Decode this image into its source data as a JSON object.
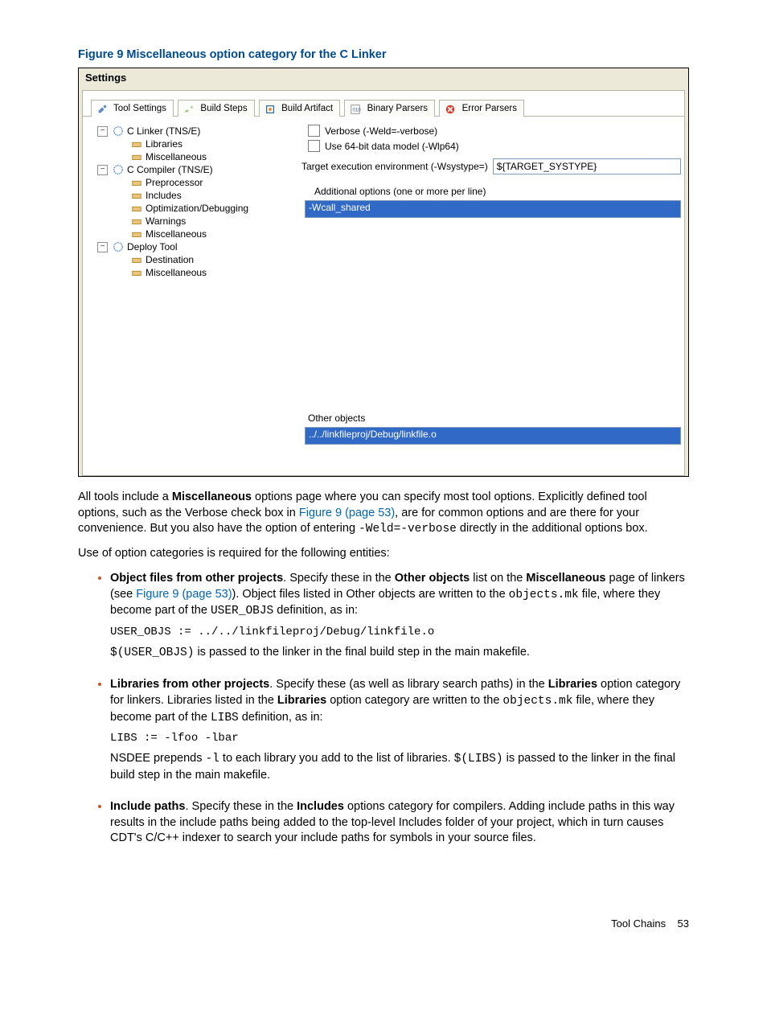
{
  "figure": {
    "caption": "Figure 9 Miscellaneous option category for the C Linker"
  },
  "settings": {
    "title": "Settings",
    "tabs": {
      "tool_settings": "Tool Settings",
      "build_steps": "Build Steps",
      "build_artifact": "Build Artifact",
      "binary_parsers": "Binary Parsers",
      "error_parsers": "Error Parsers"
    },
    "tree": {
      "c_linker": "C Linker (TNS/E)",
      "libraries": "Libraries",
      "misc1": "Miscellaneous",
      "c_compiler": "C Compiler (TNS/E)",
      "preprocessor": "Preprocessor",
      "includes": "Includes",
      "opt_debug": "Optimization/Debugging",
      "warnings": "Warnings",
      "misc2": "Miscellaneous",
      "deploy_tool": "Deploy Tool",
      "destination": "Destination",
      "misc3": "Miscellaneous"
    },
    "right": {
      "verbose": "Verbose (-Weld=-verbose)",
      "use64": "Use 64-bit data model (-Wlp64)",
      "target_label": "Target execution environment (-Wsystype=)",
      "target_value": "${TARGET_SYSTYPE}",
      "additional_label": "Additional options (one or more per line)",
      "additional_value": "-Wcall_shared",
      "other_label": "Other objects",
      "other_value": "../../linkfileproj/Debug/linkfile.o"
    }
  },
  "para": {
    "p1a": "All tools include a ",
    "p1b": "Miscellaneous",
    "p1c": " options page where you can specify most tool options. Explicitly defined tool options, such as the Verbose check box in ",
    "p1link": "Figure 9 (page 53)",
    "p1d": ", are for common options and are there for your convenience. But you also have the option of entering ",
    "p1code": "-Weld=-verbose",
    "p1e": " directly in the additional options box.",
    "p2": "Use of option categories is required for the following entities:"
  },
  "bullets": {
    "b1": {
      "t1": "Object files from other projects",
      "t2": ". Specify these in the ",
      "t3": "Other objects",
      "t4": " list on the ",
      "t5": "Miscellaneous",
      "t6": " page of linkers (see ",
      "link": "Figure 9 (page 53)",
      "t7": "). Object files listed in Other objects are written to the ",
      "code1": "objects.mk",
      "t8": " file, where they become part of the ",
      "code2": "USER_OBJS",
      "t9": " definition, as in:",
      "codeblock": "USER_OBJS := ../../linkfileproj/Debug/linkfile.o",
      "after1": "$(USER_OBJS)",
      "after2": " is passed to the linker in the final build step in the main makefile."
    },
    "b2": {
      "t1": "Libraries from other projects",
      "t2": ". Specify these (as well as library search paths) in the ",
      "t3": "Libraries",
      "t4": " option category for linkers. Libraries listed in the ",
      "t5": "Libraries",
      "t6": " option category are written to the ",
      "code1": "objects.mk",
      "t7": " file, where they become part of the ",
      "code2": "LIBS",
      "t8": " definition, as in:",
      "codeblock": "LIBS := -lfoo -lbar",
      "after1": "NSDEE prepends ",
      "aftercode1": "-l",
      "after2": " to each library you add to the list of libraries. ",
      "aftercode2": "$(LIBS)",
      "after3": " is passed to the linker in the final build step in the main makefile."
    },
    "b3": {
      "t1": "Include paths",
      "t2": ". Specify these in the ",
      "t3": "Includes",
      "t4": " options category for compilers. Adding include paths in this way results in the include paths being added to the top-level Includes folder of your project, which in turn causes CDT's C/C++ indexer to search your include paths for symbols in your source files."
    }
  },
  "footer": {
    "label": "Tool Chains",
    "page": "53"
  }
}
